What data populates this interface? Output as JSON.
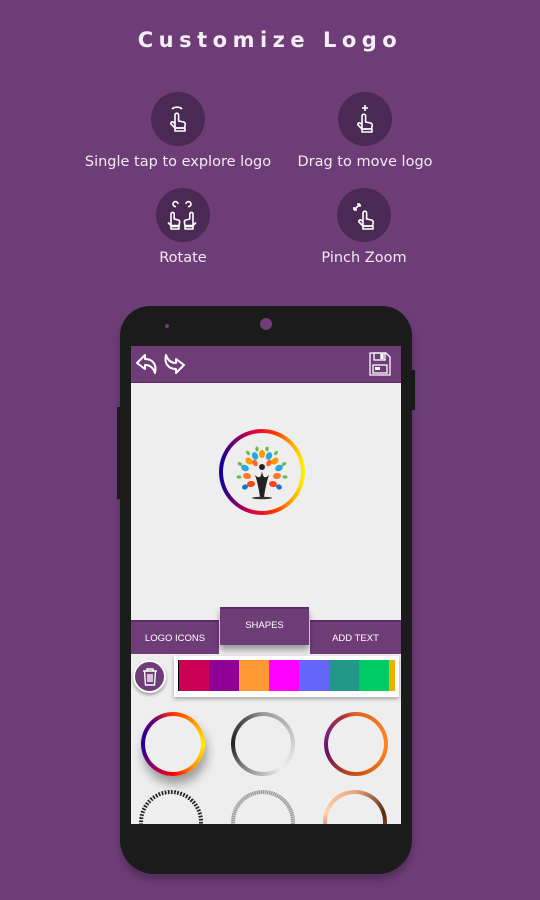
{
  "header": {
    "title": "Customize Logo"
  },
  "hints": [
    {
      "icon": "tap-gesture-icon",
      "label": "Single tap to explore logo"
    },
    {
      "icon": "drag-gesture-icon",
      "label": "Drag to move logo"
    },
    {
      "icon": "rotate-gesture-icon",
      "label": "Rotate"
    },
    {
      "icon": "pinch-zoom-gesture-icon",
      "label": "Pinch Zoom"
    }
  ],
  "app": {
    "toolbar": {
      "undo": "undo-icon",
      "redo": "redo-icon",
      "save": "save-icon"
    },
    "tabs": [
      {
        "label": "LOGO ICONS",
        "active": false
      },
      {
        "label": "SHAPES",
        "active": true
      },
      {
        "label": "ADD TEXT",
        "active": false
      }
    ],
    "palette": [
      "#cc0055",
      "#8e0096",
      "#ff9933",
      "#ff00ff",
      "#6666ff",
      "#229988",
      "#00cc66",
      "#eeb300"
    ],
    "shapes": [
      "rainbow-ring",
      "silver-ring",
      "purple-orange-ring",
      "dotted-black-ring",
      "textured-gray-ring",
      "copper-ring"
    ]
  },
  "colors": {
    "brand": "#6e3d78",
    "dark": "#4a2954"
  }
}
